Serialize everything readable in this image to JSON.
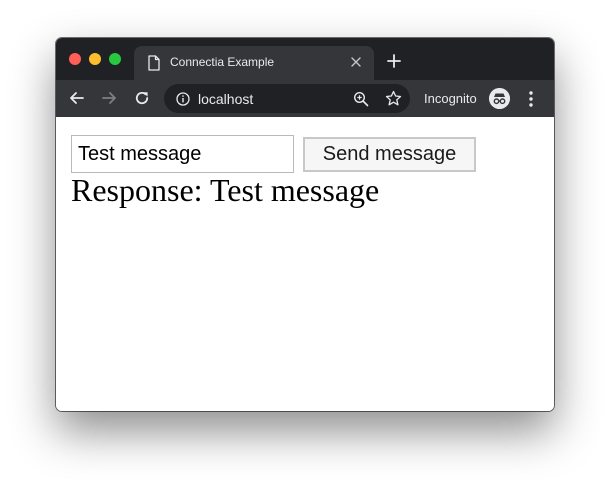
{
  "browser": {
    "tab": {
      "title": "Connectia Example",
      "icon": "page-icon"
    },
    "toolbar": {
      "url": "localhost",
      "profile_label": "Incognito",
      "icons": [
        "back-arrow-icon",
        "forward-arrow-icon",
        "reload-icon",
        "info-icon",
        "zoom-icon",
        "star-icon",
        "incognito-icon",
        "menu-dots-icon"
      ]
    },
    "window_controls": [
      "close",
      "minimize",
      "maximize"
    ],
    "colors": {
      "tabstrip": "#202124",
      "toolbar": "#35363a",
      "omnibox": "#202124",
      "text": "#e8eaed"
    }
  },
  "page": {
    "message_input": {
      "value": "Test message"
    },
    "send_button": {
      "label": "Send message"
    },
    "response_text": "Response: Test message"
  }
}
